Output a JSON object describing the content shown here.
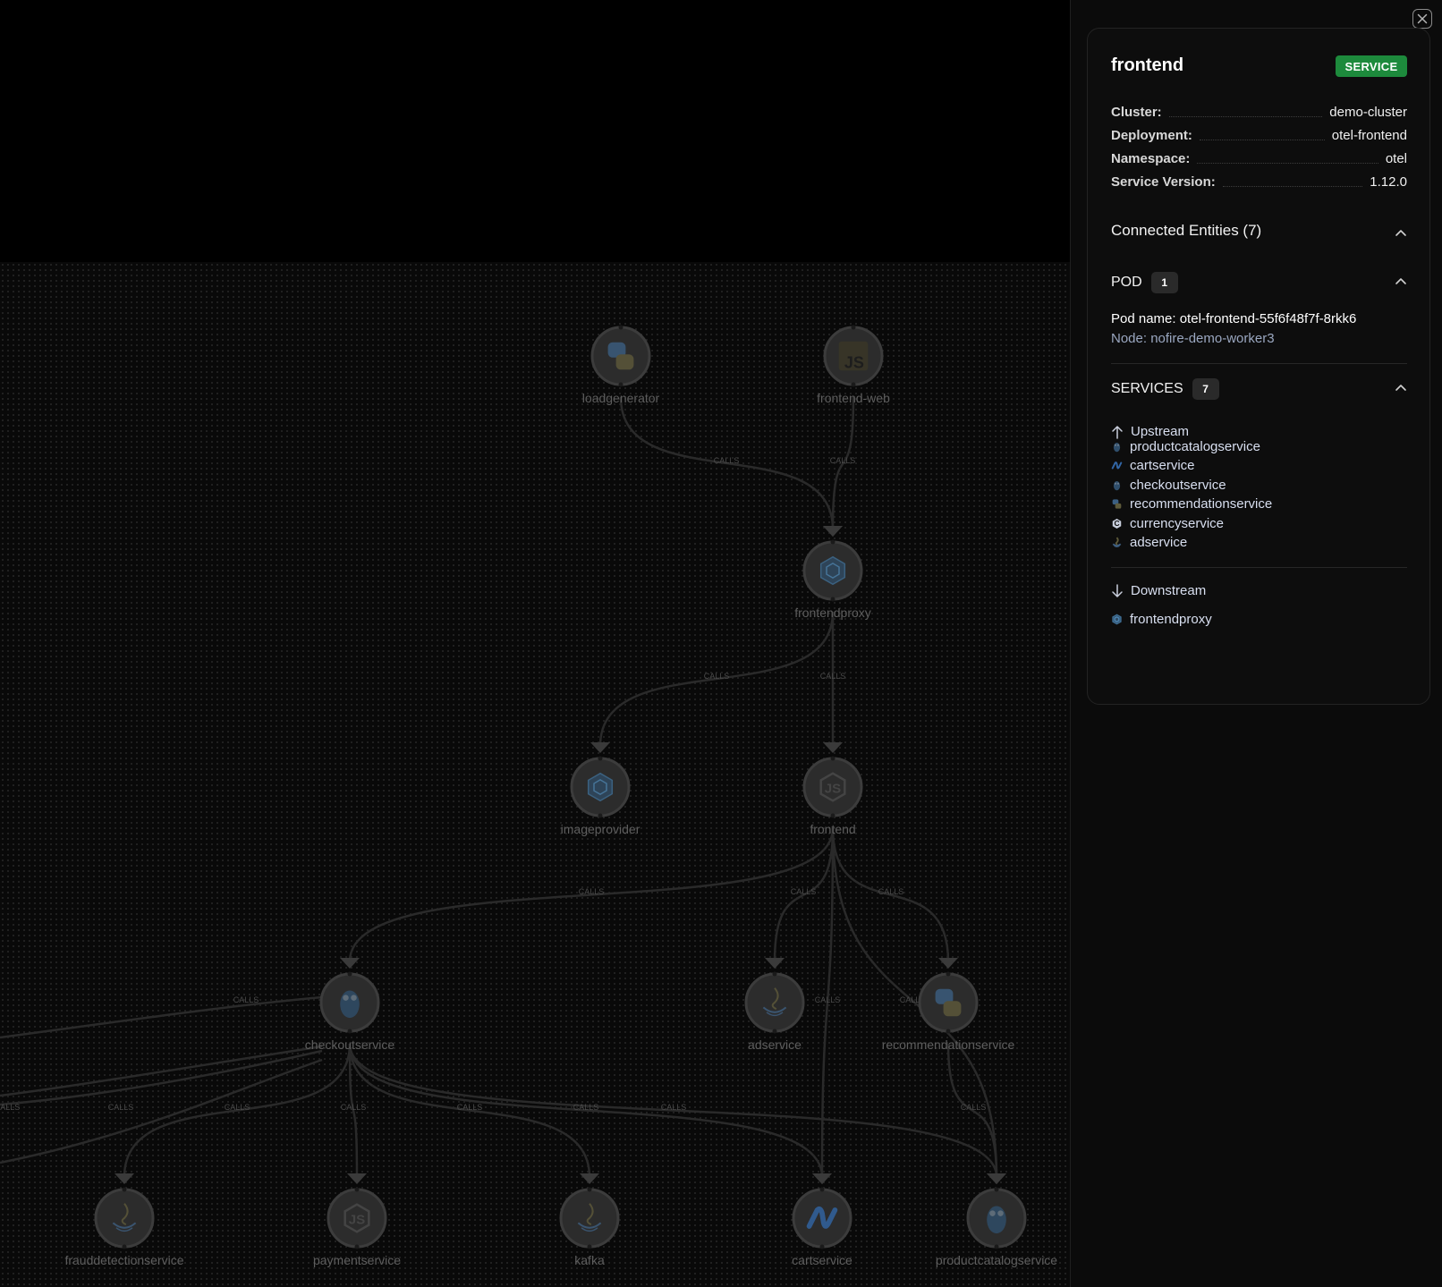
{
  "graph": {
    "edge_label": "CALLS",
    "nodes": [
      {
        "id": "loadgenerator",
        "label": "loadgenerator",
        "icon": "python-icon"
      },
      {
        "id": "frontend-web",
        "label": "frontend-web",
        "icon": "javascript-icon"
      },
      {
        "id": "frontendproxy",
        "label": "frontendproxy",
        "icon": "envoy-icon"
      },
      {
        "id": "imageprovider",
        "label": "imageprovider",
        "icon": "envoy-icon"
      },
      {
        "id": "frontend",
        "label": "frontend",
        "icon": "nodejs-icon"
      },
      {
        "id": "checkoutservice",
        "label": "checkoutservice",
        "icon": "go-gopher-icon"
      },
      {
        "id": "adservice",
        "label": "adservice",
        "icon": "java-icon"
      },
      {
        "id": "recommendationservice",
        "label": "recommendationservice",
        "icon": "python-icon"
      },
      {
        "id": "frauddetectionservice",
        "label": "frauddetectionservice",
        "icon": "java-icon"
      },
      {
        "id": "paymentservice",
        "label": "paymentservice",
        "icon": "nodejs-icon"
      },
      {
        "id": "kafka",
        "label": "kafka",
        "icon": "java-icon"
      },
      {
        "id": "cartservice",
        "label": "cartservice",
        "icon": "dotnet-icon"
      },
      {
        "id": "productcatalogservice",
        "label": "productcatalogservice",
        "icon": "go-gopher-icon"
      }
    ]
  },
  "panel": {
    "title": "frontend",
    "badge": "SERVICE",
    "details": [
      {
        "key": "Cluster:",
        "value": "demo-cluster"
      },
      {
        "key": "Deployment:",
        "value": "otel-frontend"
      },
      {
        "key": "Namespace:",
        "value": "otel"
      },
      {
        "key": "Service Version:",
        "value": "1.12.0"
      }
    ],
    "connected_title": "Connected Entities (7)",
    "pod": {
      "label": "POD",
      "count": "1",
      "name_text": "Pod name: otel-frontend-55f6f48f7f-8rkk6",
      "node_text": "Node: nofire-demo-worker3"
    },
    "services": {
      "label": "SERVICES",
      "count": "7",
      "upstream_label": "Upstream",
      "upstream": [
        {
          "name": "productcatalogservice",
          "icon": "go-gopher-icon"
        },
        {
          "name": "cartservice",
          "icon": "dotnet-icon"
        },
        {
          "name": "checkoutservice",
          "icon": "go-gopher-icon"
        },
        {
          "name": "recommendationservice",
          "icon": "python-icon"
        },
        {
          "name": "currencyservice",
          "icon": "cpp-icon"
        },
        {
          "name": "adservice",
          "icon": "java-icon"
        }
      ],
      "downstream_label": "Downstream",
      "downstream": [
        {
          "name": "frontendproxy",
          "icon": "envoy-icon"
        }
      ]
    }
  },
  "colors": {
    "badge": "#1d8a3c",
    "background": "#000000",
    "panel": "#0b0b0b"
  }
}
